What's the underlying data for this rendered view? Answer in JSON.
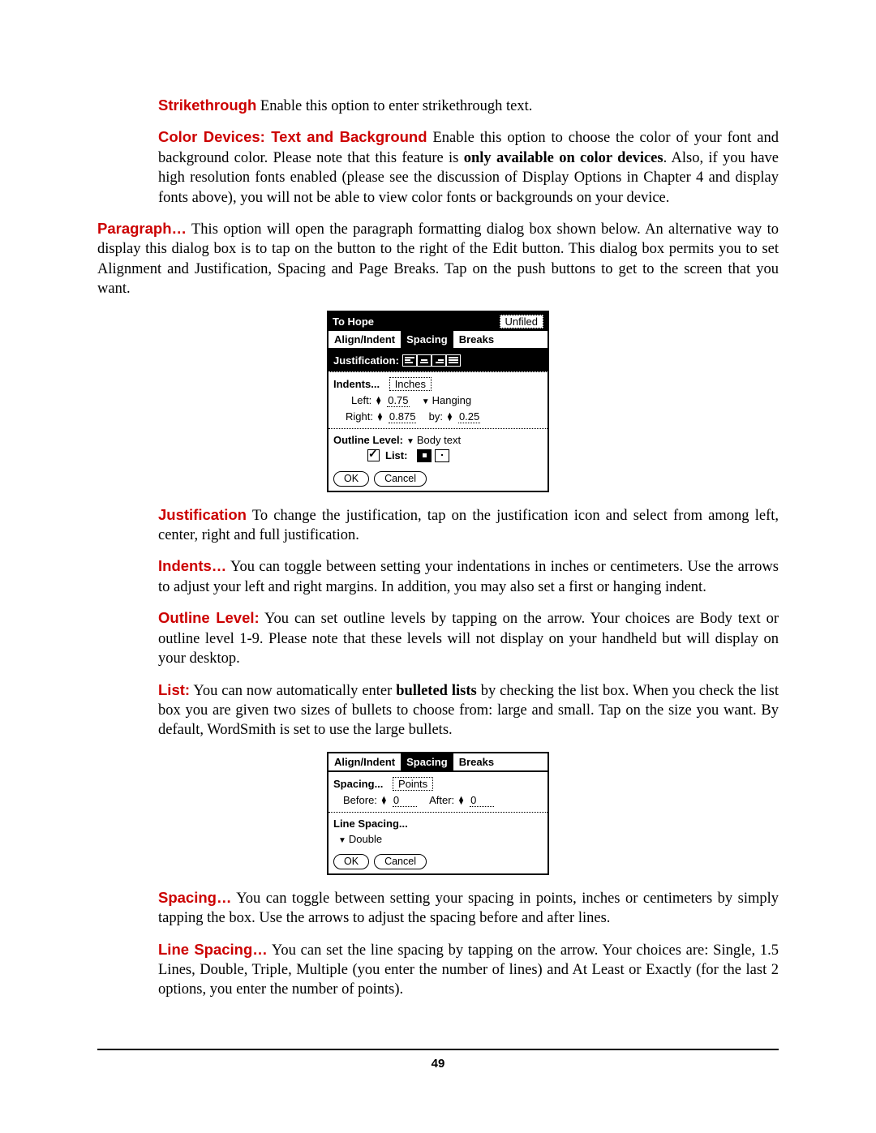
{
  "p_strike_label": "Strikethrough",
  "p_strike_body": "   Enable this option to enter strikethrough text.",
  "p_color_label": "Color Devices:  Text and Background",
  "p_color_body1": "   Enable this option to choose the color of your font and background color.  Please note that this feature is ",
  "p_color_bold": "only available on color devices",
  "p_color_body2": ".  Also, if you have high resolution fonts enabled (please see the discussion of Display Options in Chapter 4 and display fonts above), you will not be able to view color fonts or backgrounds on your device.",
  "p_para_label": "Paragraph…",
  "p_para_body": "  This option will open the paragraph formatting dialog box shown below.  An alternative way to display this dialog box is to tap on the button to the right of the Edit button. This dialog box permits you to set Alignment and Justification, Spacing and Page Breaks.  Tap on the push buttons to get to the screen that you want.",
  "dlg1": {
    "title": "To Hope",
    "category": "Unfiled",
    "tabs": [
      "Align/Indent",
      "Spacing",
      "Breaks"
    ],
    "just_label": "Justification:",
    "indents_label": "Indents...",
    "indents_unit": "Inches",
    "left_label": "Left:",
    "left_val": "0.75",
    "hanging": "Hanging",
    "right_label": "Right:",
    "right_val": "0.875",
    "by_label": "by:",
    "by_val": "0.25",
    "outline_label": "Outline Level:",
    "outline_val": "Body text",
    "list_label": "List:",
    "ok": "OK",
    "cancel": "Cancel"
  },
  "p_just_label": "Justification",
  "p_just_body": "   To change the justification, tap on the justification icon and select from among left, center, right and full justification.",
  "p_ind_label": "Indents…",
  "p_ind_body": "   You can toggle between setting your indentations in inches or centimeters.  Use the arrows to adjust your left and right margins.  In addition, you may also set a first or hanging indent.",
  "p_out_label": "Outline Level:",
  "p_out_body": "  You can set outline levels by tapping on the arrow.  Your choices are Body text or outline level 1-9.  Please note that these levels will not display on your handheld but will display on your desktop.",
  "p_list_label": "List:",
  "p_list_body1": "  You can now automatically enter ",
  "p_list_bold": "bulleted lists",
  "p_list_body2": " by checking the list box.  When you check the list box you are given two sizes of bullets to choose from:  large and small.  Tap on the size you want.  By default, WordSmith is set to use the large bullets.",
  "dlg2": {
    "tabs": [
      "Align/Indent",
      "Spacing",
      "Breaks"
    ],
    "spacing_label": "Spacing...",
    "spacing_unit": "Points",
    "before_label": "Before:",
    "before_val": "0",
    "after_label": "After:",
    "after_val": "0",
    "line_label": "Line Spacing...",
    "line_val": "Double",
    "ok": "OK",
    "cancel": "Cancel"
  },
  "p_sp_label": "Spacing…",
  "p_sp_body": "    You can toggle between setting your spacing in points, inches or centimeters by simply tapping the box.  Use the arrows to adjust the spacing before and after lines.",
  "p_ls_label": "Line Spacing…",
  "p_ls_body": "    You can set the line spacing by tapping on the arrow.  Your choices are: Single, 1.5 Lines, Double, Triple, Multiple (you enter the number of lines) and At Least or Exactly (for the last 2 options, you enter the number of points).",
  "page_number": "49"
}
